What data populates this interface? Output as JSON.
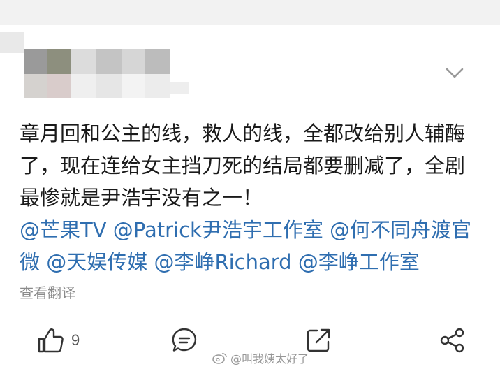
{
  "post": {
    "body": "章月回和公主的线，救人的线，全都改给别人辅酶了，现在连给女主挡刀死的结局都要删减了，全剧最惨就是尹浩宇没有之一！",
    "mentions": [
      {
        "text": "@芒果TV"
      },
      {
        "text": "@Patrick尹浩宇工作室"
      },
      {
        "text": "@何不同舟渡官微"
      },
      {
        "text": "@天娱传媒"
      },
      {
        "text": "@李峥Richard"
      },
      {
        "text": "@李峥工作室"
      }
    ],
    "translate_label": "查看翻译"
  },
  "actions": {
    "like_icon": "thumbs-up-icon",
    "like_count": "9",
    "comment_icon": "comment-icon",
    "repost_icon": "repost-icon",
    "share_icon": "share-icon"
  },
  "header": {
    "expand_icon": "chevron-down-icon"
  },
  "watermark": {
    "text": "@叫我姨太好了",
    "icon": "weibo-logo-icon"
  },
  "colors": {
    "mention": "#2f6eb0",
    "text": "#1a1a1a",
    "muted": "#8a8a8a"
  }
}
